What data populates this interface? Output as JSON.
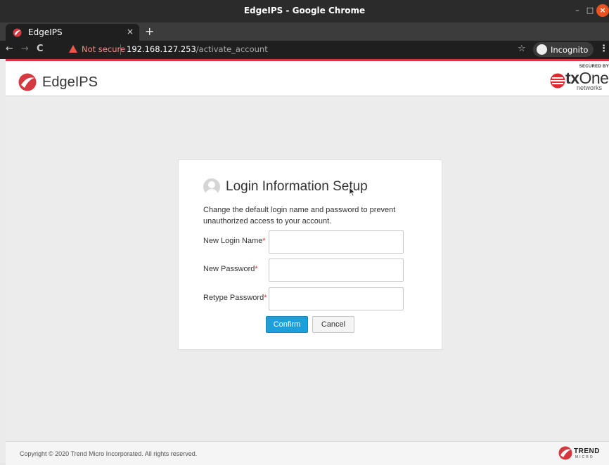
{
  "window": {
    "title": "EdgeIPS - Google Chrome"
  },
  "tab": {
    "label": "EdgeIPS",
    "close": "×",
    "new_tab": "+"
  },
  "toolbar": {
    "back": "←",
    "forward": "→",
    "reload": "C",
    "security_warning": "Not secure",
    "url_host": "192.168.127.253",
    "url_path": "/activate_account",
    "bookmark": "☆",
    "incognito_label": "Incognito",
    "menu": "⋮"
  },
  "app": {
    "name": "EdgeIPS",
    "partner": {
      "secured_by": "SECURED BY",
      "word_bold": "tx",
      "word_light": "One",
      "sub": "networks"
    }
  },
  "login": {
    "title": "Login Information Setup",
    "description": "Change the default login name and password to prevent unauthorized access to your account.",
    "fields": [
      {
        "label": "New Login Name",
        "required": "*",
        "value": "",
        "placeholder": ""
      },
      {
        "label": "New Password",
        "required": "*",
        "value": "",
        "placeholder": ""
      },
      {
        "label": "Retype Password",
        "required": "*",
        "value": "",
        "placeholder": ""
      }
    ],
    "confirm_label": "Confirm",
    "cancel_label": "Cancel"
  },
  "footer": {
    "copyright": "Copyright © 2020 Trend Micro Incorporated. All rights reserved.",
    "vendor": "TREND",
    "vendor_sub": "MICRO"
  },
  "colors": {
    "accent_red": "#d3393e",
    "confirm_blue": "#1d9fd9"
  }
}
